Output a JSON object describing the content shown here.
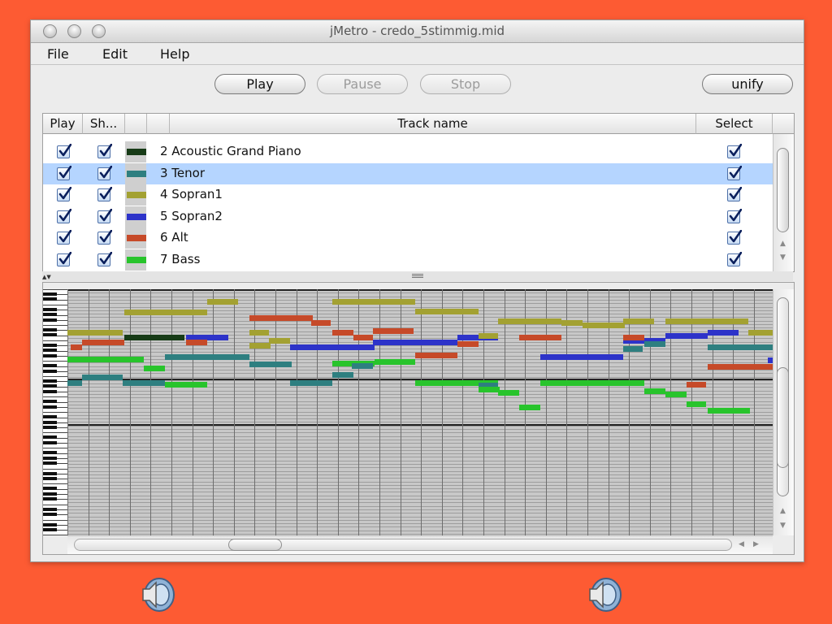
{
  "window": {
    "title": "jMetro - credo_5stimmig.mid"
  },
  "menu": [
    "File",
    "Edit",
    "Help"
  ],
  "toolbar": {
    "play": "Play",
    "pause": "Pause",
    "stop": "Stop",
    "unify": "unify"
  },
  "table": {
    "columns": {
      "play": "Play",
      "show": "Sh...",
      "name": "Track name",
      "select": "Select"
    },
    "rows": [
      {
        "name": "2 Acoustic Grand Piano",
        "color": "#173b17",
        "play": true,
        "show": true,
        "select": true,
        "selected": false
      },
      {
        "name": "3 Tenor",
        "color": "#2e7f80",
        "play": true,
        "show": true,
        "select": true,
        "selected": true
      },
      {
        "name": "4 Sopran1",
        "color": "#a3a132",
        "play": true,
        "show": true,
        "select": true,
        "selected": false
      },
      {
        "name": "5 Sopran2",
        "color": "#2d33c9",
        "play": true,
        "show": true,
        "select": true,
        "selected": false
      },
      {
        "name": "6 Alt",
        "color": "#c64a29",
        "play": true,
        "show": true,
        "select": true,
        "selected": false
      },
      {
        "name": "7 Bass",
        "color": "#28c42c",
        "play": true,
        "show": true,
        "select": true,
        "selected": false
      }
    ]
  },
  "icons": {
    "speaker_left": "speaker-icon",
    "speaker_right": "speaker-icon"
  }
}
